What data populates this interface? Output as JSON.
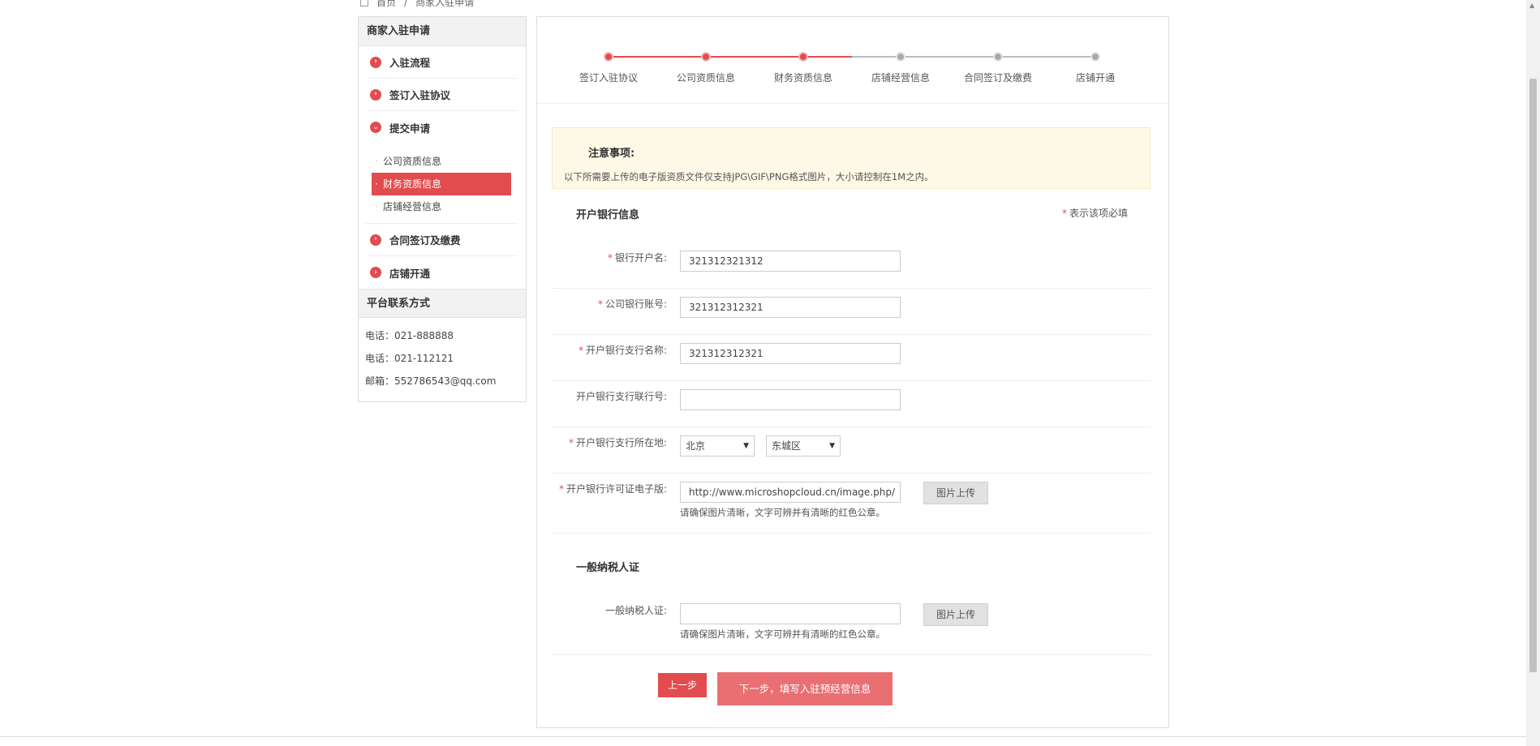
{
  "breadcrumb": {
    "home": "首页",
    "sep": "/",
    "current": "商家入驻申请"
  },
  "sidebar": {
    "title": "商家入驻申请",
    "steps": [
      {
        "label": "入驻流程",
        "icon": "chevron-right-icon"
      },
      {
        "label": "签订入驻协议",
        "icon": "chevron-right-icon"
      },
      {
        "label": "提交申请",
        "icon": "chevron-down-icon"
      }
    ],
    "sub_items": [
      "公司资质信息",
      "财务资质信息",
      "店铺经营信息"
    ],
    "steps_after": [
      {
        "label": "合同签订及缴费",
        "icon": "chevron-right-icon"
      },
      {
        "label": "店铺开通",
        "icon": "chevron-right-icon"
      }
    ],
    "contact_title": "平台联系方式",
    "contacts": [
      "电话：021-888888",
      "电话：021-112121",
      "邮箱：552786543@qq.com"
    ]
  },
  "progress": {
    "steps": [
      "签订入驻协议",
      "公司资质信息",
      "财务资质信息",
      "店铺经营信息",
      "合同签订及缴费",
      "店铺开通"
    ],
    "completed_count": 3
  },
  "notice": {
    "title": "注意事项:",
    "text": "以下所需要上传的电子版资质文件仅支持JPG\\GIF\\PNG格式图片，大小请控制在1M之内。"
  },
  "bank_section": {
    "title": "开户银行信息",
    "required_note": "表示该项必填",
    "fields": {
      "account_name": {
        "label": "银行开户名:",
        "value": "321312321312"
      },
      "account_number": {
        "label": "公司银行账号:",
        "value": "321312312321"
      },
      "branch_name": {
        "label": "开户银行支行名称:",
        "value": "321312312321"
      },
      "branch_code": {
        "label": "开户银行支行联行号:",
        "value": ""
      },
      "branch_location": {
        "label": "开户银行支行所在地:",
        "province": "北京",
        "district": "东城区"
      },
      "license": {
        "label": "开户银行许可证电子版:",
        "value": "http://www.microshopcloud.cn/image.php/",
        "upload": "图片上传",
        "hint": "请确保图片清晰，文字可辨并有清晰的红色公章。"
      }
    }
  },
  "tax_section": {
    "title": "一般纳税人证",
    "field": {
      "label": "一般纳税人证:",
      "value": "",
      "upload": "图片上传",
      "hint": "请确保图片清晰，文字可辨并有清晰的红色公章。"
    }
  },
  "buttons": {
    "prev": "上一步",
    "next": "下一步，填写入驻预经营信息"
  },
  "required_mark": "*",
  "colors": {
    "accent": "#e24c4f",
    "next_button": "#e96f72",
    "notice_bg": "#fdf9e6"
  }
}
